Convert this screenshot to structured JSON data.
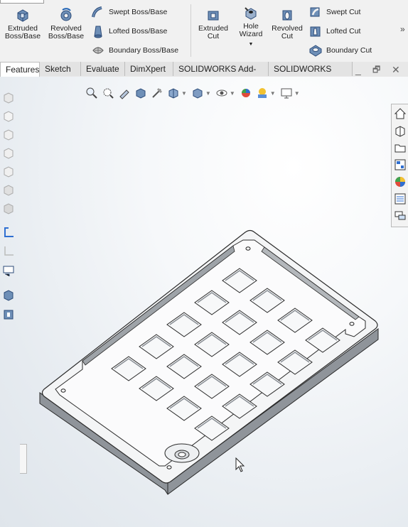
{
  "ribbon": {
    "extruded_boss": "Extruded Boss/Base",
    "revolved_boss": "Revolved Boss/Base",
    "swept_boss": "Swept Boss/Base",
    "lofted_boss": "Lofted Boss/Base",
    "boundary_boss": "Boundary Boss/Base",
    "extruded_cut": "Extruded Cut",
    "hole_wizard": "Hole Wizard",
    "revolved_cut": "Revolved Cut",
    "swept_cut": "Swept Cut",
    "lofted_cut": "Lofted Cut",
    "boundary_cut": "Boundary Cut",
    "more": "»"
  },
  "tabs": [
    "Features",
    "Sketch",
    "Evaluate",
    "DimXpert",
    "SOLIDWORKS Add-Ins",
    "SOLIDWORKS MBD"
  ],
  "window": {
    "minimize": "_",
    "restore": "🗗",
    "close": "✕"
  },
  "heads_up_toolbar": [
    "zoom-to-fit-icon",
    "zoom-to-area-icon",
    "previous-view-icon",
    "section-view-icon",
    "dynamic-annotation-icon",
    "view-orientation-icon",
    "display-style-icon",
    "hide-show-items-icon",
    "edit-appearance-icon",
    "apply-scene-icon",
    "view-settings-icon"
  ],
  "left_strip_icons": [
    "cube-front-icon",
    "cube-back-icon",
    "cube-left-icon",
    "cube-right-icon",
    "cube-top-icon",
    "cube-bottom-icon",
    "cube-iso-icon",
    "sketch-plane-icon",
    "sketch-plane-2-icon",
    "display-pane-icon",
    "extrude-small-icon",
    "part-small-icon"
  ],
  "task_pane_icons": [
    "home-icon",
    "parts-library-icon",
    "file-explorer-icon",
    "view-palette-icon",
    "appearances-icon",
    "custom-properties-icon",
    "forum-icon"
  ],
  "colors": {
    "ribbon_bg": "#f1f1f1",
    "accent_blue": "#1f62b4",
    "part_face": "#f4f5f6",
    "part_edge": "#2a2a2a"
  }
}
